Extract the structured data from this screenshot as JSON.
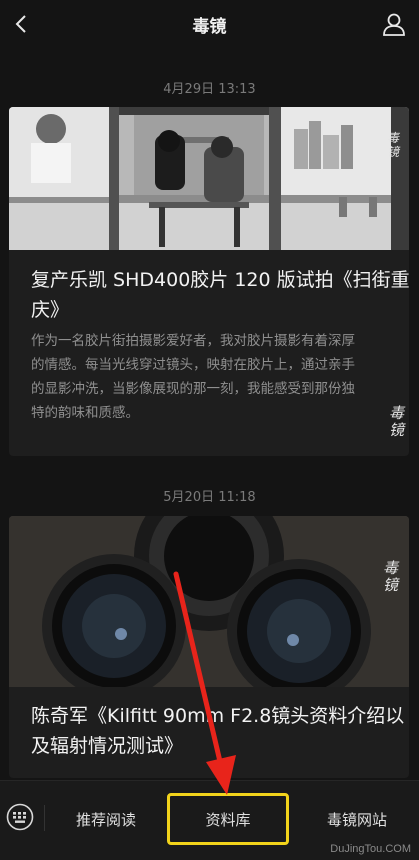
{
  "header": {
    "title": "毒镜",
    "back_icon": "chevron-left-icon",
    "profile_icon": "user-icon"
  },
  "articles": [
    {
      "timestamp": "4月29日 13:13",
      "title_line1": "复产乐凯 SHD400胶片 120 版试拍《扫街重",
      "title_line2": "庆》",
      "desc_lines": [
        "作为一名胶片街拍摄影爱好者，我对胶片摄影有着深厚",
        "的情感。每当光线穿过镜头，映射在胶片上，通过亲手",
        "的显影冲洗，当影像展现的那一刻，我能感受到那份独",
        "特的韵味和质感。"
      ],
      "seal_text": "毒镜"
    },
    {
      "timestamp": "5月20日 11:18",
      "title_line1": "陈奇军《Kilfitt 90mm F2.8镜头资料介绍以",
      "title_line2": "及辐射情况测试》",
      "seal_text": "毒镜"
    }
  ],
  "bottom_nav": {
    "keyboard_icon": "keyboard-icon",
    "items": [
      "推荐阅读",
      "资料库",
      "毒镜网站"
    ],
    "highlight_color": "#f2d31b"
  },
  "annotation": {
    "arrow_color": "#e8241b"
  },
  "watermark": "DuJingTou.COM"
}
